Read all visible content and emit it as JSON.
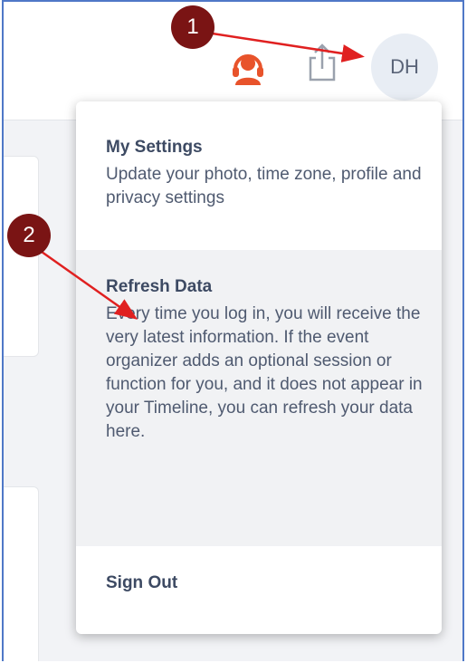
{
  "header": {
    "support_icon": "headset-icon",
    "share_icon": "share-icon",
    "avatar_initials": "DH"
  },
  "menu": {
    "settings": {
      "title": "My Settings",
      "description": "Update your photo, time zone, profile and privacy settings"
    },
    "refresh": {
      "title": "Refresh Data",
      "description": "Every time you log in, you will receive the very latest information. If the event organizer adds an optional session or function for you, and it does not appear in your Timeline, you can refresh your data here."
    },
    "sign_out": {
      "title": "Sign Out"
    }
  },
  "annotations": {
    "marker_1": "1",
    "marker_2": "2"
  },
  "colors": {
    "frame_border": "#4f78c7",
    "support_icon": "#e8532b",
    "marker_fill": "#7a1414",
    "arrow": "#e02020"
  }
}
